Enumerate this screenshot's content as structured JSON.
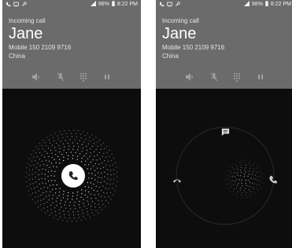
{
  "screens": [
    {
      "status": {
        "battery": "98%",
        "time": "8:22 PM"
      },
      "incoming_label": "Incoming call",
      "caller_name": "Jane",
      "caller_detail": "Mobile 150 2109 9716",
      "caller_country": "China",
      "controls": [
        "speaker-icon",
        "mute-mic-icon",
        "dialpad-icon",
        "hold-icon"
      ]
    },
    {
      "status": {
        "battery": "98%",
        "time": "8:22 PM"
      },
      "incoming_label": "Incoming call",
      "caller_name": "Jane",
      "caller_detail": "Mobile 150 2109 9716",
      "caller_country": "China",
      "controls": [
        "speaker-icon",
        "mute-mic-icon",
        "dialpad-icon",
        "hold-icon"
      ]
    }
  ],
  "colors": {
    "header": "#6b6b6b",
    "background": "#0d0d0d",
    "answer": "#ffffff"
  }
}
